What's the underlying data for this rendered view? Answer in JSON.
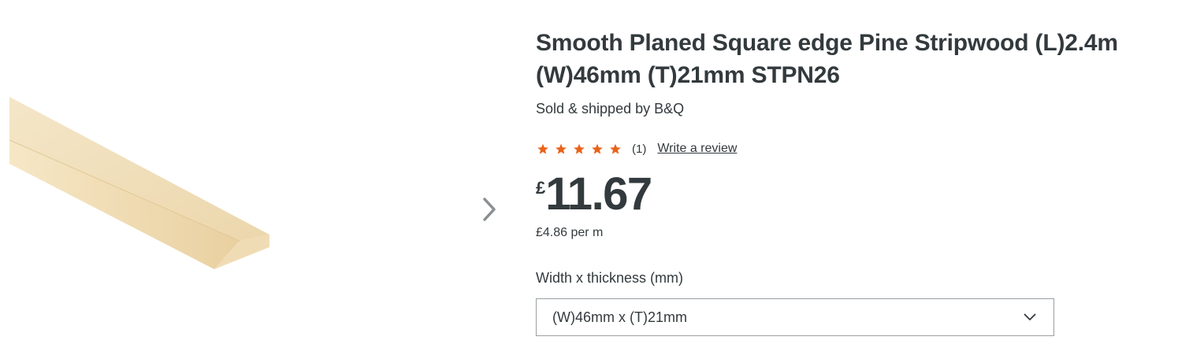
{
  "product": {
    "title": "Smooth Planed Square edge Pine Stripwood (L)2.4m (W)46mm (T)21mm STPN26",
    "seller": "Sold & shipped by B&Q",
    "rating": {
      "stars": 5,
      "max": 5,
      "count_label": "(1)",
      "write_review": "Write a review",
      "star_color": "#e8641b"
    },
    "price": {
      "currency": "£",
      "amount": "11.67",
      "unit_price": "£4.86 per m"
    },
    "option": {
      "label": "Width x thickness (mm)",
      "selected": "(W)46mm x (T)21mm"
    }
  },
  "gallery": {
    "next_icon": "chevron-right-icon"
  }
}
